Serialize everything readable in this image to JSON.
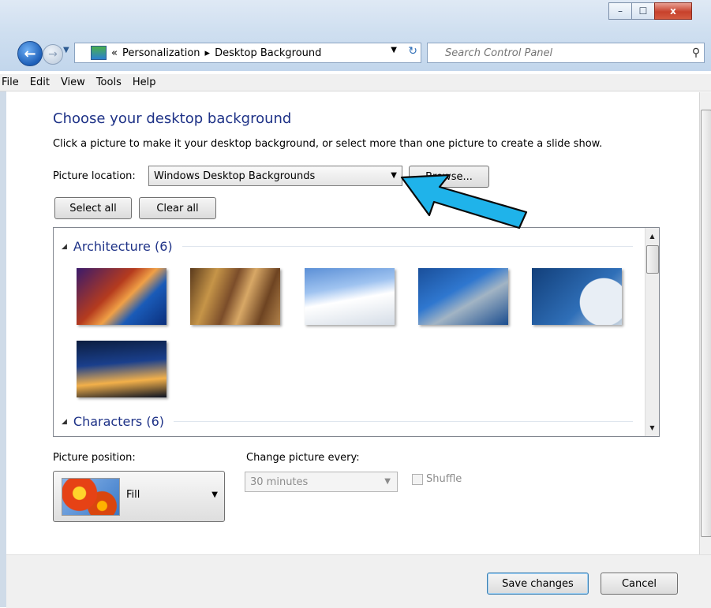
{
  "window": {
    "controls": {
      "minimize": "–",
      "maximize": "☐",
      "close": "x"
    }
  },
  "nav": {
    "breadcrumbs": [
      "«",
      "Personalization",
      "▸",
      "Desktop Background"
    ],
    "search_placeholder": "Search Control Panel"
  },
  "menu": [
    "File",
    "Edit",
    "View",
    "Tools",
    "Help"
  ],
  "page": {
    "heading": "Choose your desktop background",
    "description": "Click a picture to make it your desktop background, or select more than one picture to create a slide show.",
    "picture_location_label": "Picture location:",
    "picture_location_value": "Windows Desktop Backgrounds",
    "browse_label": "Browse...",
    "select_all_label": "Select all",
    "clear_all_label": "Clear all"
  },
  "gallery": {
    "groups": [
      {
        "name": "Architecture (6)"
      },
      {
        "name": "Characters (6)"
      }
    ]
  },
  "settings": {
    "picture_position_label": "Picture position:",
    "picture_position_value": "Fill",
    "change_picture_label": "Change picture every:",
    "change_picture_value": "30 minutes",
    "shuffle_label": "Shuffle"
  },
  "footer": {
    "save_label": "Save changes",
    "cancel_label": "Cancel"
  },
  "colors": {
    "heading": "#1e3287",
    "annotation_arrow": "#1fb3ea"
  }
}
